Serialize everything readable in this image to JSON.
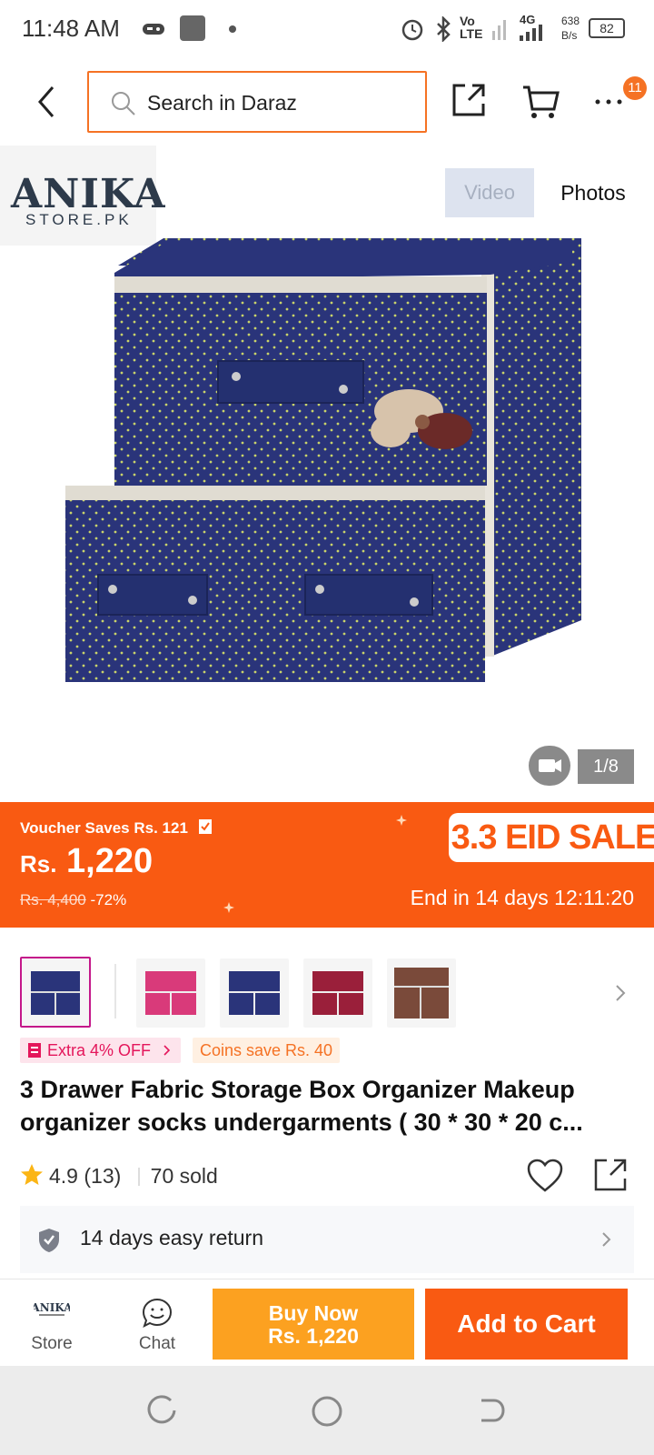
{
  "status_bar": {
    "time": "11:48 AM",
    "network": "Vo LTE",
    "net_type": "4G",
    "speed": "638",
    "speed_unit": "B/s",
    "battery": "82"
  },
  "header": {
    "search_placeholder": "Search in Daraz",
    "cart_badge": "11"
  },
  "gallery": {
    "store_logo_top": "ANIKA",
    "store_logo_bottom": "STORE.PK",
    "tab_video": "Video",
    "tab_photos": "Photos",
    "counter": "1/8"
  },
  "promo": {
    "voucher": "Voucher Saves Rs. 121",
    "currency": "Rs.",
    "price": "1,220",
    "original_price": "Rs. 4,400",
    "discount": "-72%",
    "sale_label": "3.3 EID SALE",
    "ends_in": "End in 14 days 12:11:20"
  },
  "tags": {
    "extra_off": "Extra 4% OFF",
    "coins": "Coins save Rs. 40"
  },
  "product": {
    "title": "3 Drawer Fabric Storage Box Organizer Makeup organizer socks undergarments ( 30 * 30 * 20 c...",
    "rating": "4.9",
    "reviews": "(13)",
    "sold": "70 sold",
    "return_policy": "14 days easy return"
  },
  "bottom_bar": {
    "store_label": "Store",
    "chat_label": "Chat",
    "buy_now": "Buy Now",
    "buy_now_price": "Rs. 1,220",
    "add_to_cart": "Add to Cart"
  },
  "colors": {
    "accent": "#f57224",
    "promo_bg": "#f95a12",
    "buy_now_bg": "#fca120",
    "product_navy": "#2a347a"
  }
}
